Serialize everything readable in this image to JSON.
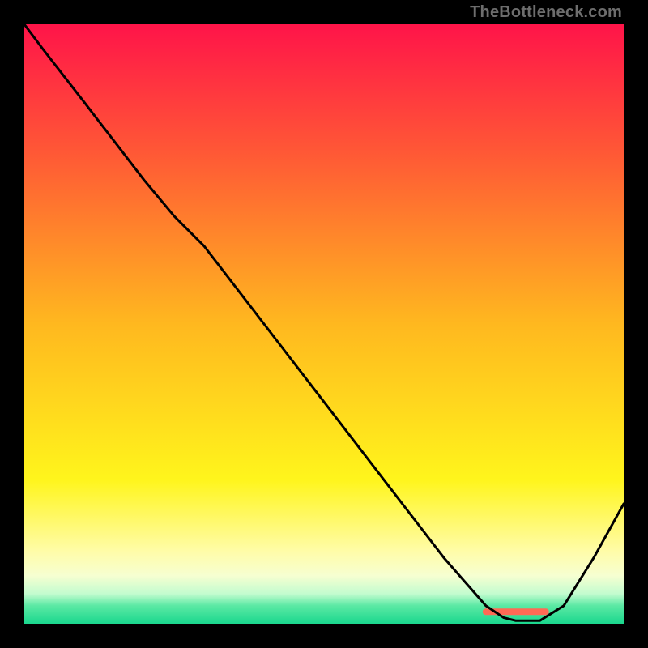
{
  "watermark": "TheBottleneck.com",
  "chart_data": {
    "type": "line",
    "title": "",
    "xlabel": "",
    "ylabel": "",
    "xlim": [
      0,
      100
    ],
    "ylim": [
      0,
      100
    ],
    "grid": false,
    "legend": false,
    "background_gradient_stops": [
      {
        "pct": 0,
        "color": "#ff1449"
      },
      {
        "pct": 22,
        "color": "#ff5a35"
      },
      {
        "pct": 50,
        "color": "#ffb81f"
      },
      {
        "pct": 76,
        "color": "#fff51c"
      },
      {
        "pct": 88,
        "color": "#fffca9"
      },
      {
        "pct": 92,
        "color": "#f6ffd1"
      },
      {
        "pct": 95,
        "color": "#c3fccf"
      },
      {
        "pct": 97,
        "color": "#5be9a4"
      },
      {
        "pct": 100,
        "color": "#1ad78e"
      }
    ],
    "series": [
      {
        "name": "bottleneck-curve",
        "color": "#000000",
        "x": [
          0,
          3,
          10,
          20,
          25,
          30,
          40,
          50,
          60,
          70,
          77,
          80,
          82,
          86,
          90,
          95,
          100
        ],
        "values": [
          100,
          96,
          87,
          74,
          68,
          63,
          50,
          37,
          24,
          11,
          3,
          1,
          0.5,
          0.5,
          3,
          11,
          20
        ]
      }
    ],
    "annotations": [
      {
        "name": "optimal-band",
        "type": "segment",
        "color": "#ff6a55",
        "y": 2,
        "x0": 77,
        "x1": 87,
        "thickness_px": 8
      }
    ]
  }
}
